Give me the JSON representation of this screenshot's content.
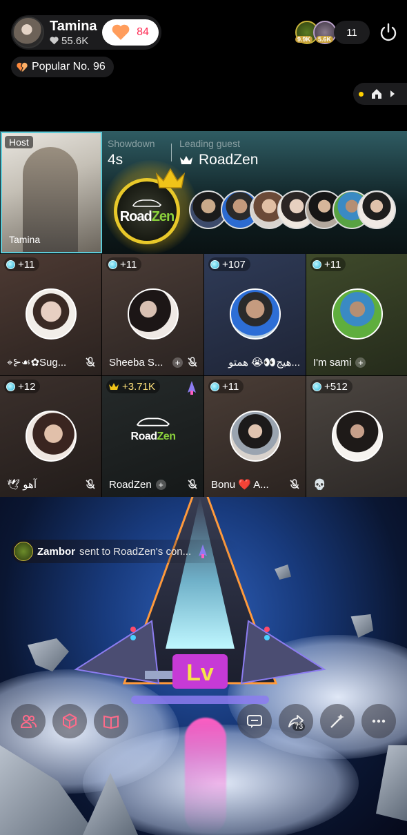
{
  "host": {
    "name": "Tamina",
    "likes": "55.6K",
    "follow_count": "84",
    "popular": "Popular No. 96"
  },
  "top_right": {
    "viewer_badges": [
      "9.9K",
      "5.6K"
    ],
    "viewer_count": "11"
  },
  "showdown": {
    "host_tag": "Host",
    "host_name": "Tamina",
    "label": "Showdown",
    "timer": "4s",
    "leading_label": "Leading guest",
    "leading_name": "RoadZen",
    "badge_text_a": "Road",
    "badge_text_b": "Zen"
  },
  "tiles": [
    {
      "badge": "+11",
      "name": "⌖⊱☙✿Sug...",
      "plus": false,
      "muted": true
    },
    {
      "badge": "+11",
      "name": "Sheeba S...",
      "plus": true,
      "muted": true
    },
    {
      "badge": "+107",
      "name": "هيج👀😭 همتو...",
      "plus": false,
      "muted": false
    },
    {
      "badge": "+11",
      "name": "I'm sami",
      "plus": true,
      "muted": false
    },
    {
      "badge": "+12",
      "name": "🕊 آهو",
      "plus": false,
      "muted": true
    },
    {
      "badge": "+3.71K",
      "name": "RoadZen",
      "plus": true,
      "muted": true
    },
    {
      "badge": "+11",
      "name": "Bonu ❤️ A...",
      "plus": false,
      "muted": true
    },
    {
      "badge": "+512",
      "name": "💀",
      "plus": false,
      "muted": false
    }
  ],
  "roadzen_logo": {
    "a": "Road",
    "b": "Zen"
  },
  "gift_toast": {
    "user": "Zambor",
    "text": "sent to RoadZen's con..."
  },
  "bottom_bar": {
    "share_count": "73"
  },
  "colors": {
    "accent": "#fe2c55",
    "gem": "#2db5d9",
    "gold": "#e8c82a",
    "zen_green": "#8bd13c"
  }
}
